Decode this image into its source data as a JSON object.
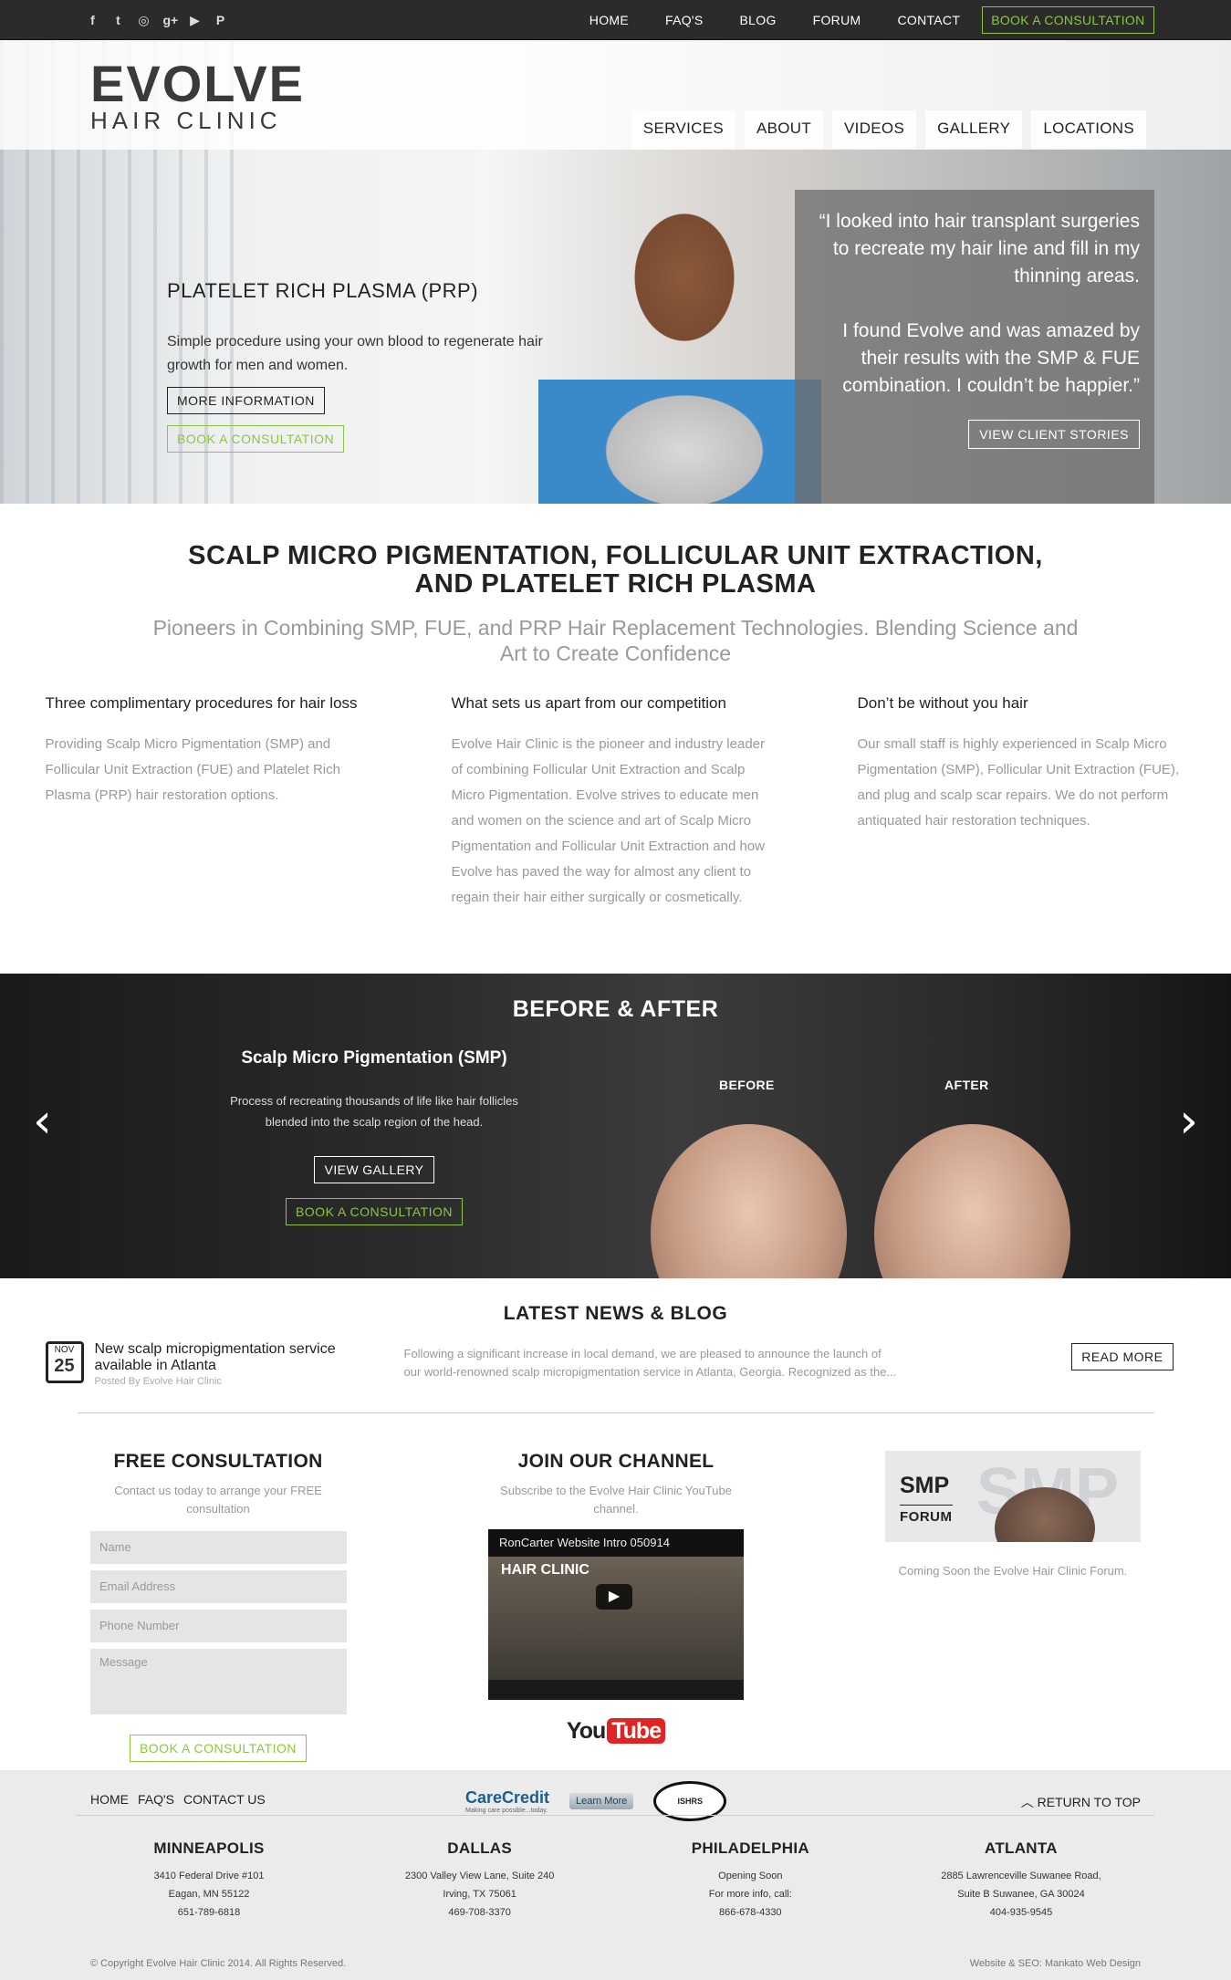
{
  "social": {
    "icons": [
      "facebook-icon",
      "twitter-icon",
      "instagram-icon",
      "google-plus-icon",
      "youtube-icon",
      "pinterest-icon"
    ],
    "glyphs": [
      "f",
      "t",
      "◎",
      "g+",
      "▶",
      "P"
    ]
  },
  "topnav": {
    "items": [
      "HOME",
      "FAQ'S",
      "BLOG",
      "FORUM",
      "CONTACT"
    ],
    "cta": "BOOK A CONSULTATION"
  },
  "logo": {
    "line1": "EVOLVE",
    "line2": "HAIR CLINIC"
  },
  "mainnav": {
    "items": [
      "SERVICES",
      "ABOUT",
      "VIDEOS",
      "GALLERY",
      "LOCATIONS"
    ]
  },
  "hero": {
    "title": "PLATELET RICH PLASMA (PRP)",
    "text": "Simple procedure using your own blood to regenerate hair growth for men and women.",
    "more_button": "MORE INFORMATION",
    "book_button": "BOOK A CONSULTATION",
    "quote1": "“I looked into hair transplant surgeries to recreate my hair line and fill in my thinning areas.",
    "quote2": "I found Evolve and was amazed by their results with the SMP & FUE combination. I couldn’t be happier.”",
    "stories_button": "VIEW CLIENT STORIES"
  },
  "intro": {
    "heading_line1": "SCALP MICRO PIGMENTATION, FOLLICULAR UNIT EXTRACTION,",
    "heading_line2": "AND PLATELET RICH PLASMA",
    "subheading": "Pioneers in Combining SMP, FUE, and PRP Hair Replacement Technologies. Blending Science and Art to Create Confidence",
    "columns": [
      {
        "title": "Three complimentary procedures for hair loss",
        "body": "Providing Scalp Micro Pigmentation (SMP) and Follicular Unit Extraction (FUE) and Platelet Rich Plasma (PRP) hair restoration options."
      },
      {
        "title": "What sets us apart from our competition",
        "body": "Evolve Hair Clinic is the pioneer and industry leader of combining Follicular Unit Extraction and Scalp Micro Pigmentation. Evolve strives to educate men and women on the science and art of Scalp Micro Pigmentation and Follicular Unit Extraction and how Evolve has paved the way for almost any client to regain their hair either surgically or cosmetically."
      },
      {
        "title": "Don’t be without you hair",
        "body": "Our small staff is highly experienced in Scalp Micro Pigmentation (SMP), Follicular Unit Extraction (FUE), and plug and scalp scar repairs. We do not perform antiquated hair restoration techniques."
      }
    ]
  },
  "before_after": {
    "heading": "BEFORE & AFTER",
    "slide_title": "Scalp Micro Pigmentation (SMP)",
    "slide_text": "Process of recreating thousands of life like hair follicles blended into the scalp region of the head.",
    "gallery_button": "VIEW GALLERY",
    "book_button": "BOOK A CONSULTATION",
    "before_label": "BEFORE",
    "after_label": "AFTER",
    "prev_glyph": "‹",
    "next_glyph": "›"
  },
  "news": {
    "heading": "LATEST NEWS & BLOG",
    "month": "NOV",
    "day": "25",
    "title": "New scalp micropigmentation service available in Atlanta",
    "byline": "Posted By Evolve Hair Clinic",
    "excerpt": "Following a significant increase in local demand, we are pleased to announce the launch of our world-renowned scalp micropigmentation service in Atlanta, Georgia. Recognized as the...",
    "read_more": "READ MORE"
  },
  "consultation": {
    "heading": "FREE CONSULTATION",
    "text": "Contact us today to arrange your FREE consultation",
    "name_placeholder": "Name",
    "email_placeholder": "Email Address",
    "phone_placeholder": "Phone Number",
    "message_placeholder": "Message",
    "submit": "BOOK A CONSULTATION"
  },
  "channel": {
    "heading": "JOIN OUR CHANNEL",
    "text": "Subscribe to the Evolve Hair Clinic YouTube channel.",
    "video_title": "RonCarter Website Intro 050914",
    "video_overlay": "HAIR CLINIC",
    "play_glyph": "▶",
    "youtube_you": "You",
    "youtube_tube": "Tube"
  },
  "forum": {
    "smp": "SMP",
    "forum": "FORUM",
    "bg": "SMP",
    "text": "Coming Soon the Evolve Hair Clinic Forum."
  },
  "footer": {
    "links": [
      "HOME",
      "FAQ'S",
      "CONTACT US"
    ],
    "carecredit": "CareCredit",
    "carecredit_tag": "Making care possible...today.",
    "learn_more": "Learn More",
    "seal": "ISHRS",
    "return_top": "RETURN TO TOP",
    "cities": [
      {
        "name": "MINNEAPOLIS",
        "l1": "3410 Federal Drive #101",
        "l2": "Eagan, MN 55122",
        "l3": "651-789-6818"
      },
      {
        "name": "DALLAS",
        "l1": "2300 Valley View Lane, Suite 240",
        "l2": "Irving, TX 75061",
        "l3": "469-708-3370"
      },
      {
        "name": "PHILADELPHIA",
        "l1": "Opening Soon",
        "l2": "For more info, call:",
        "l3": "866-678-4330"
      },
      {
        "name": "ATLANTA",
        "l1": "2885 Lawrenceville Suwanee Road,",
        "l2": "Suite B Suwanee, GA 30024",
        "l3": "404-935-9545"
      }
    ],
    "copyright": "© Copyright Evolve Hair Clinic 2014. All Rights Reserved.",
    "credit": "Website & SEO: Mankato Web Design"
  },
  "colors": {
    "accent": "#8cc63f",
    "dark": "#2b2b2b",
    "footer_bg": "#ebebeb"
  }
}
